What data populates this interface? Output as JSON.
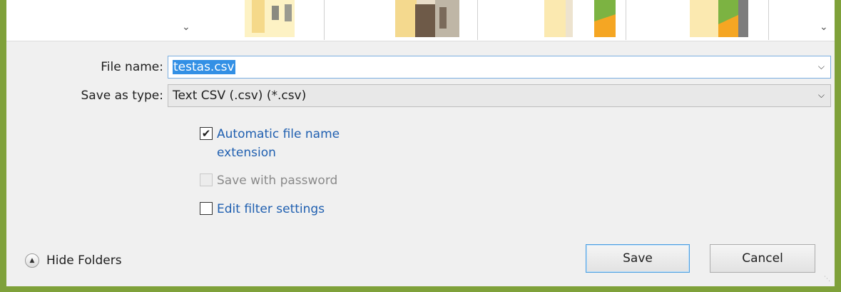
{
  "colors": {
    "frame": "#7fa13a",
    "dialog_bg": "#f0f0f0",
    "selection": "#3390e5",
    "link_blue": "#1f5fb0"
  },
  "form": {
    "file_name_label": "File name:",
    "file_name_value": "testas.csv",
    "save_as_type_label": "Save as type:",
    "save_as_type_value": "Text CSV (.csv) (*.csv)"
  },
  "options": [
    {
      "label": "Automatic file name extension",
      "line1": "Automatic file name",
      "line2": "extension",
      "checked": true,
      "enabled": true
    },
    {
      "label": "Save with password",
      "checked": false,
      "enabled": false
    },
    {
      "label": "Edit filter settings",
      "checked": false,
      "enabled": true
    }
  ],
  "footer": {
    "hide_folders_label": "Hide Folders",
    "save_label": "Save",
    "cancel_label": "Cancel"
  },
  "icons": {
    "strip_left": "chevron-down-icon",
    "strip_right": "chevron-down-icon",
    "dropdown": "chevron-down-icon",
    "hide_folders": "chevron-up-circle-icon",
    "check": "checkmark-icon",
    "grip": "resize-grip-icon"
  }
}
